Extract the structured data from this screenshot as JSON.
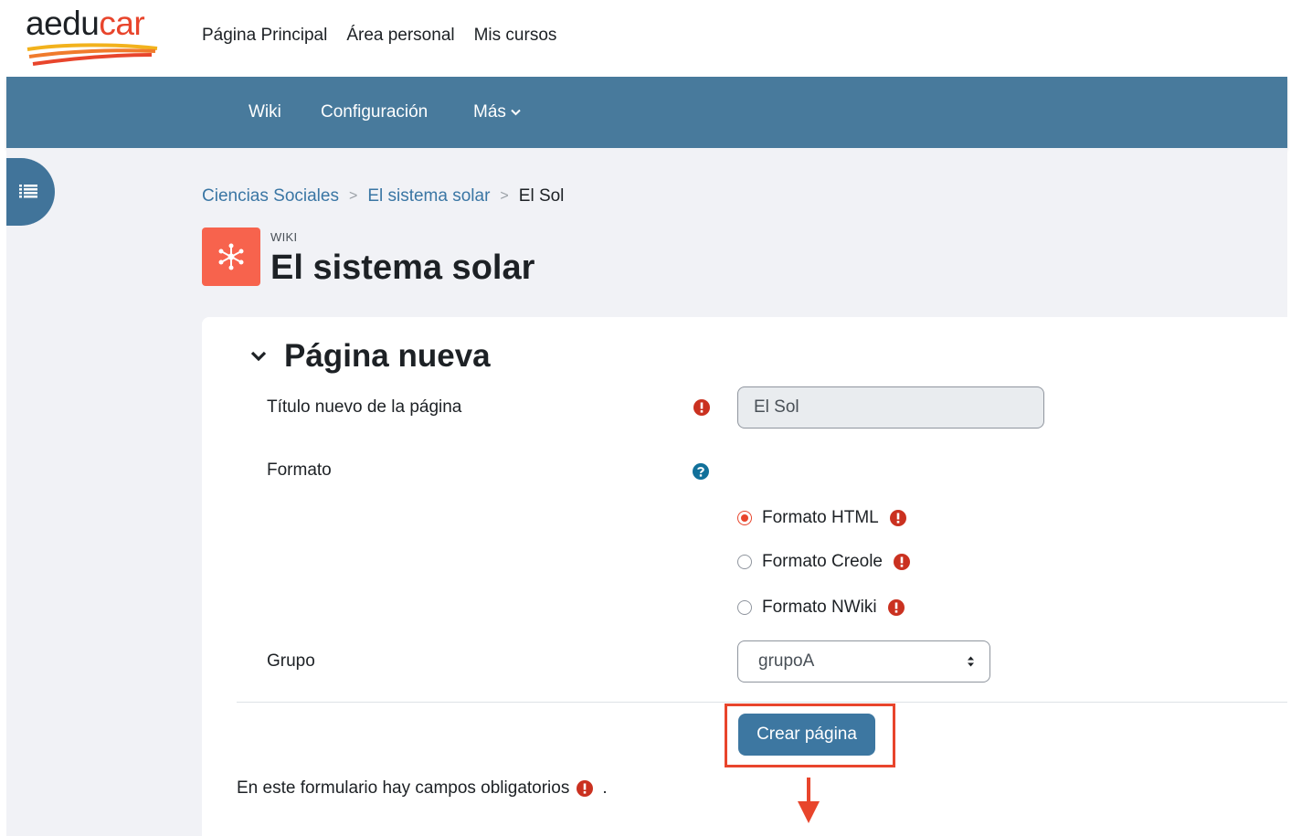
{
  "brand": {
    "logo_part1": "aedu",
    "logo_part2": "car"
  },
  "topnav": [
    "Página Principal",
    "Área personal",
    "Mis cursos"
  ],
  "secondary_nav": {
    "wiki": "Wiki",
    "config": "Configuración",
    "more": "Más"
  },
  "breadcrumb": {
    "course": "Ciencias Sociales",
    "activity": "El sistema solar",
    "current": "El Sol"
  },
  "activity": {
    "kind": "WIKI",
    "title": "El sistema solar"
  },
  "form": {
    "section_title": "Página nueva",
    "title_label": "Título nuevo de la página",
    "title_value": "El Sol",
    "format_label": "Formato",
    "formats": [
      "Formato HTML",
      "Formato Creole",
      "Formato NWiki"
    ],
    "selected_format": "Formato HTML",
    "group_label": "Grupo",
    "group_value": "grupoA",
    "submit_label": "Crear página",
    "required_note": "En este formulario hay campos obligatorios",
    "required_note_end": "."
  },
  "colors": {
    "nav_bar": "#487a9c",
    "accent": "#e8452c",
    "link": "#3a76a4",
    "button": "#3d77a1",
    "wiki_icon_bg": "#f7634d"
  },
  "icons": {
    "required": "exclamation-circle-icon",
    "help": "question-circle-icon",
    "drawer": "list-icon",
    "activity": "wiki-network-icon"
  }
}
